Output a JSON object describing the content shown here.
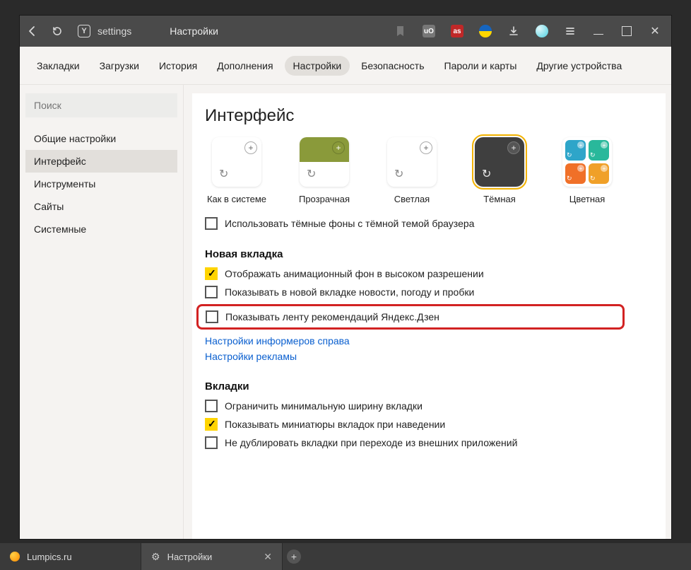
{
  "titlebar": {
    "host": "settings",
    "page_title": "Настройки"
  },
  "topnav": {
    "tabs": [
      {
        "label": "Закладки"
      },
      {
        "label": "Загрузки"
      },
      {
        "label": "История"
      },
      {
        "label": "Дополнения"
      },
      {
        "label": "Настройки",
        "active": true
      },
      {
        "label": "Безопасность"
      },
      {
        "label": "Пароли и карты"
      },
      {
        "label": "Другие устройства"
      }
    ]
  },
  "sidebar": {
    "search_placeholder": "Поиск",
    "items": [
      {
        "label": "Общие настройки"
      },
      {
        "label": "Интерфейс",
        "active": true
      },
      {
        "label": "Инструменты"
      },
      {
        "label": "Сайты"
      },
      {
        "label": "Системные"
      }
    ]
  },
  "main": {
    "heading": "Интерфейс",
    "themes": [
      {
        "label": "Как в системе"
      },
      {
        "label": "Прозрачная"
      },
      {
        "label": "Светлая"
      },
      {
        "label": "Тёмная",
        "selected": true
      },
      {
        "label": "Цветная"
      }
    ],
    "dark_bg_check": {
      "checked": false,
      "label": "Использовать тёмные фоны с тёмной темой браузера"
    },
    "section_newtab": {
      "title": "Новая вкладка",
      "rows": [
        {
          "checked": true,
          "label": "Отображать анимационный фон в высоком разрешении"
        },
        {
          "checked": false,
          "label": "Показывать в новой вкладке новости, погоду и пробки"
        },
        {
          "checked": false,
          "label": "Показывать ленту рекомендаций Яндекс.Дзен",
          "highlight": true
        }
      ],
      "links": [
        "Настройки информеров справа",
        "Настройки рекламы"
      ]
    },
    "section_tabs": {
      "title": "Вкладки",
      "rows": [
        {
          "checked": false,
          "label": "Ограничить минимальную ширину вкладки"
        },
        {
          "checked": true,
          "label": "Показывать миниатюры вкладок при наведении"
        },
        {
          "checked": false,
          "label": "Не дублировать вкладки при переходе из внешних приложений"
        }
      ]
    }
  },
  "tabstrip": {
    "tabs": [
      {
        "label": "Lumpics.ru",
        "icon": "lump"
      },
      {
        "label": "Настройки",
        "icon": "gear",
        "active": true
      }
    ]
  }
}
